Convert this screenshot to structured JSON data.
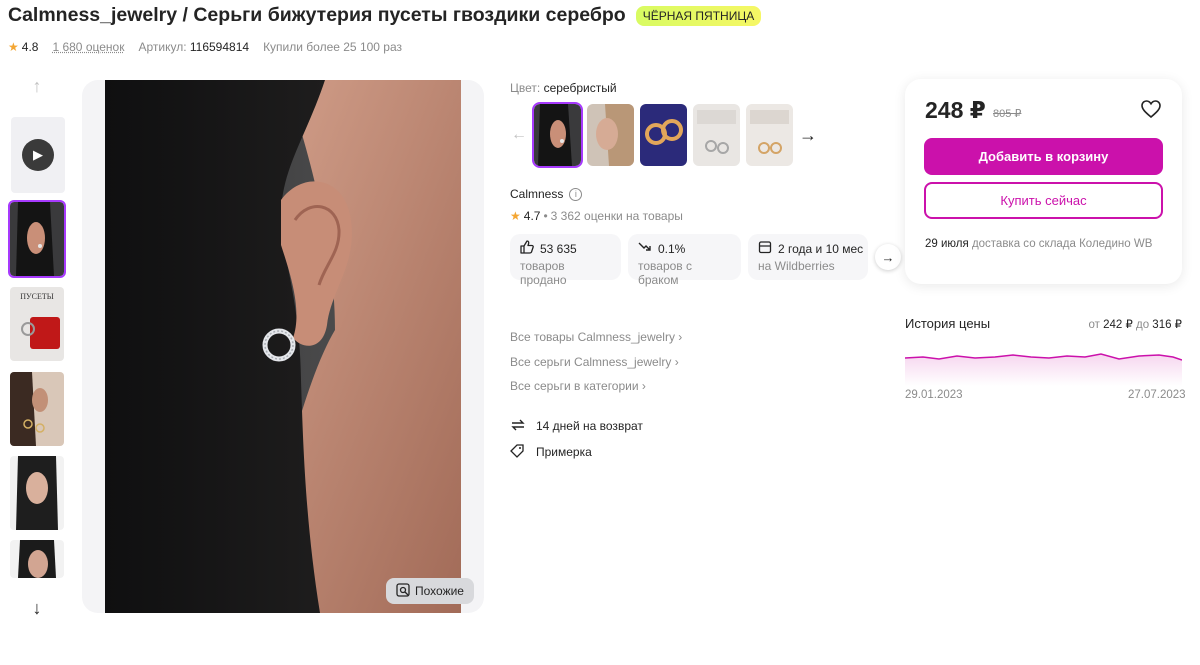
{
  "product": {
    "title": "Calmness_jewelry / Серьги бижутерия пусеты гвоздики серебро",
    "promo_badge": "ЧЁРНАЯ ПЯТНИЦА",
    "rating": "4.8",
    "reviews": "1 680 оценок",
    "article_label": "Артикул:",
    "article_value": "116594814",
    "bought": "Купили более 25 100 раз"
  },
  "gallery": {
    "similar_label": "Похожие"
  },
  "color": {
    "label": "Цвет:",
    "value": "серебристый"
  },
  "brand": {
    "name": "Calmness",
    "info_icon": "i",
    "rating": "4.7",
    "rating_sep": "•",
    "ratings_count": "3 362 оценки на товары"
  },
  "stats": [
    {
      "value": "53 635",
      "caption": "товаров продано",
      "icon": "thumbs-up-icon"
    },
    {
      "value": "0.1%",
      "caption": "товаров с браком",
      "icon": "trend-down-icon"
    },
    {
      "value": "2 года и 10 мес",
      "caption": "на Wildberries",
      "icon": "store-icon"
    }
  ],
  "links": [
    "Все товары Calmness_jewelry ›",
    "Все серьги Calmness_jewelry ›",
    "Все серьги в категории ›"
  ],
  "services": [
    {
      "label": "14 дней на возврат",
      "icon": "return-icon"
    },
    {
      "label": "Примерка",
      "icon": "tag-icon"
    }
  ],
  "buy": {
    "price": "248 ₽",
    "old_price": "805 ₽",
    "add_to_cart": "Добавить в корзину",
    "buy_now": "Купить сейчас",
    "delivery_date": "29 июля",
    "delivery_text": "доставка со склада Коледино WB"
  },
  "price_history": {
    "title": "История цены",
    "range_from_label": "от",
    "range_from": "242 ₽",
    "range_to_label": "до",
    "range_to": "316 ₽",
    "date_start": "29.01.2023",
    "date_end": "27.07.2023"
  },
  "colors": {
    "accent": "#cb11ab",
    "selection": "#a73afd"
  }
}
